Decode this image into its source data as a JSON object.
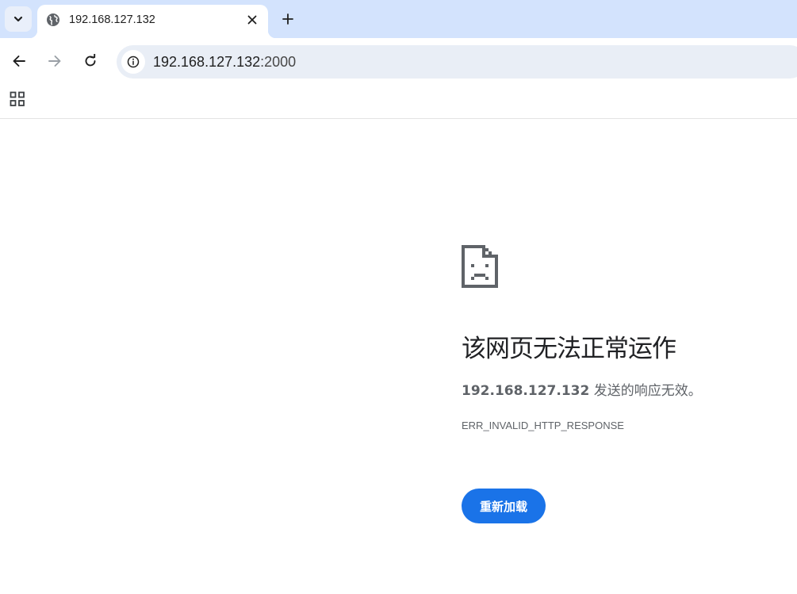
{
  "tabstrip": {
    "search_icon": "chevron-down-icon",
    "tab": {
      "title": "192.168.127.132",
      "favicon": "globe-icon",
      "close_icon": "close-icon"
    },
    "new_tab_icon": "plus-icon"
  },
  "toolbar": {
    "back_icon": "arrow-left-icon",
    "forward_icon": "arrow-right-icon",
    "reload_icon": "reload-icon",
    "site_info_icon": "info-icon",
    "url_host": "192.168.127.132",
    "url_port": ":2000"
  },
  "bookmarks_bar": {
    "apps_icon": "apps-grid-icon"
  },
  "error_page": {
    "icon": "sad-document-icon",
    "heading": "该网页无法正常运作",
    "description_host": "192.168.127.132",
    "description_text": " 发送的响应无效。",
    "error_code": "ERR_INVALID_HTTP_RESPONSE",
    "reload_button": "重新加载",
    "accent_color": "#1a73e8"
  }
}
